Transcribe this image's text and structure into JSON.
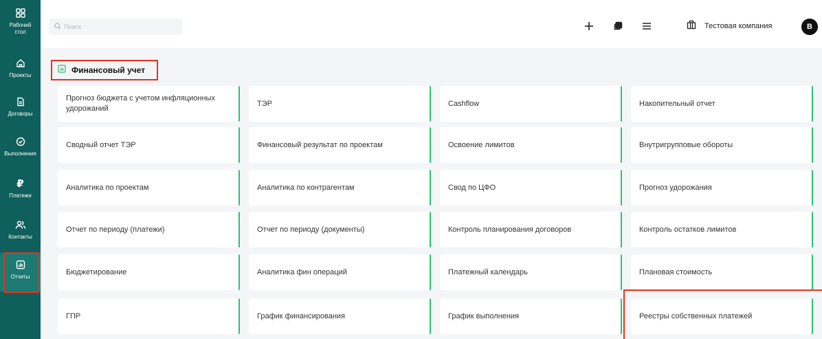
{
  "sidebar": {
    "items": [
      {
        "label": "Рабочий\nстол",
        "icon": "dashboard-grid-icon"
      },
      {
        "label": "Проекты",
        "icon": "home-icon"
      },
      {
        "label": "Договоры",
        "icon": "document-icon"
      },
      {
        "label": "Выполнения",
        "icon": "check-circle-icon"
      },
      {
        "label": "Платежи",
        "icon": "ruble-icon"
      },
      {
        "label": "Контакты",
        "icon": "users-icon"
      },
      {
        "label": "Отчеты",
        "icon": "bar-chart-icon"
      }
    ],
    "active": "Отчеты",
    "colors": {
      "background": "#0f5f5c",
      "active": "#1c7a72"
    }
  },
  "header": {
    "search_placeholder": "Поиск",
    "icons": [
      "plus-icon",
      "copy-icon",
      "menu-icon",
      "building-icon"
    ],
    "company": "Тестовая компания",
    "avatar": "В"
  },
  "section": {
    "title": "Финансовый учет",
    "icon": "report-chart-icon"
  },
  "reports": [
    [
      "Прогноз бюджета с учетом инфляционных удорожаний",
      "ТЭР",
      "Cashflow",
      "Накопительный отчет"
    ],
    [
      "Сводный отчет ТЭР",
      "Финансовый результат по проектам",
      "Освоение лимитов",
      "Внутригрупповые обороты"
    ],
    [
      "Аналитика по проектам",
      "Аналитика по контрагентам",
      "Свод по ЦФО",
      "Прогноз удорожания"
    ],
    [
      "Отчет по периоду (платежи)",
      "Отчет по периоду (документы)",
      "Контроль планирования договоров",
      "Контроль остатков лимитов"
    ],
    [
      "Бюджетирование",
      "Аналитика фин операций",
      "Платежный календарь",
      "Плановая стоимость"
    ],
    [
      "ГПР",
      "График финансирования",
      "График выполнения",
      "Реестры собственных платежей"
    ]
  ],
  "colors": {
    "accent_green": "#2fbf71",
    "highlight_red": "#e2331f"
  }
}
